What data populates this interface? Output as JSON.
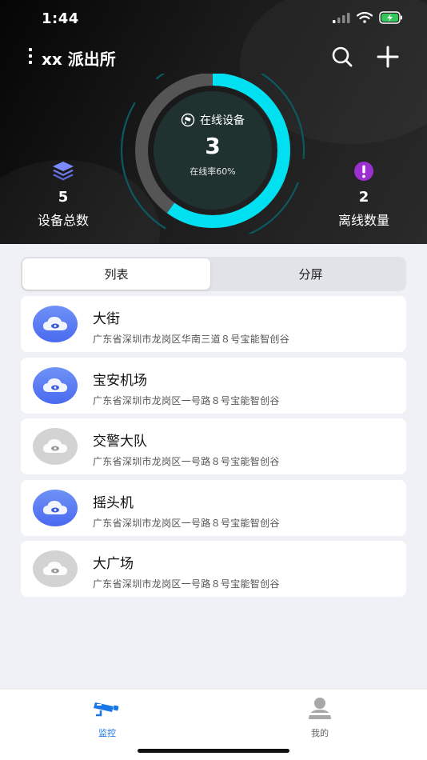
{
  "status_bar": {
    "time": "1:44"
  },
  "header": {
    "station_name": "xx 派出所"
  },
  "gauge": {
    "label": "在线设备",
    "online_count": "3",
    "rate_text": "在线率60%",
    "online_rate": 0.6,
    "arc_color": "#00e0f0"
  },
  "stats": {
    "total": {
      "value": "5",
      "label": "设备总数"
    },
    "offline": {
      "value": "2",
      "label": "离线数量"
    }
  },
  "tabs": {
    "list_label": "列表",
    "split_label": "分屏",
    "active": "list"
  },
  "devices": [
    {
      "name": "大街",
      "address": "广东省深圳市龙岗区华南三道８号宝能智创谷",
      "online": true
    },
    {
      "name": "宝安机场",
      "address": "广东省深圳市龙岗区一号路８号宝能智创谷",
      "online": true
    },
    {
      "name": "交警大队",
      "address": "广东省深圳市龙岗区一号路８号宝能智创谷",
      "online": false
    },
    {
      "name": "摇头机",
      "address": "广东省深圳市龙岗区一号路８号宝能智创谷",
      "online": true
    },
    {
      "name": "大广场",
      "address": "广东省深圳市龙岗区一号路８号宝能智创谷",
      "online": false
    }
  ],
  "tabbar": {
    "monitor_label": "监控",
    "mine_label": "我的"
  },
  "colors": {
    "accent": "#1976e8",
    "online_avatar": "#5a7cf3",
    "offline_avatar": "#d3d3d3",
    "offline_icon": "#9b2fd0"
  }
}
